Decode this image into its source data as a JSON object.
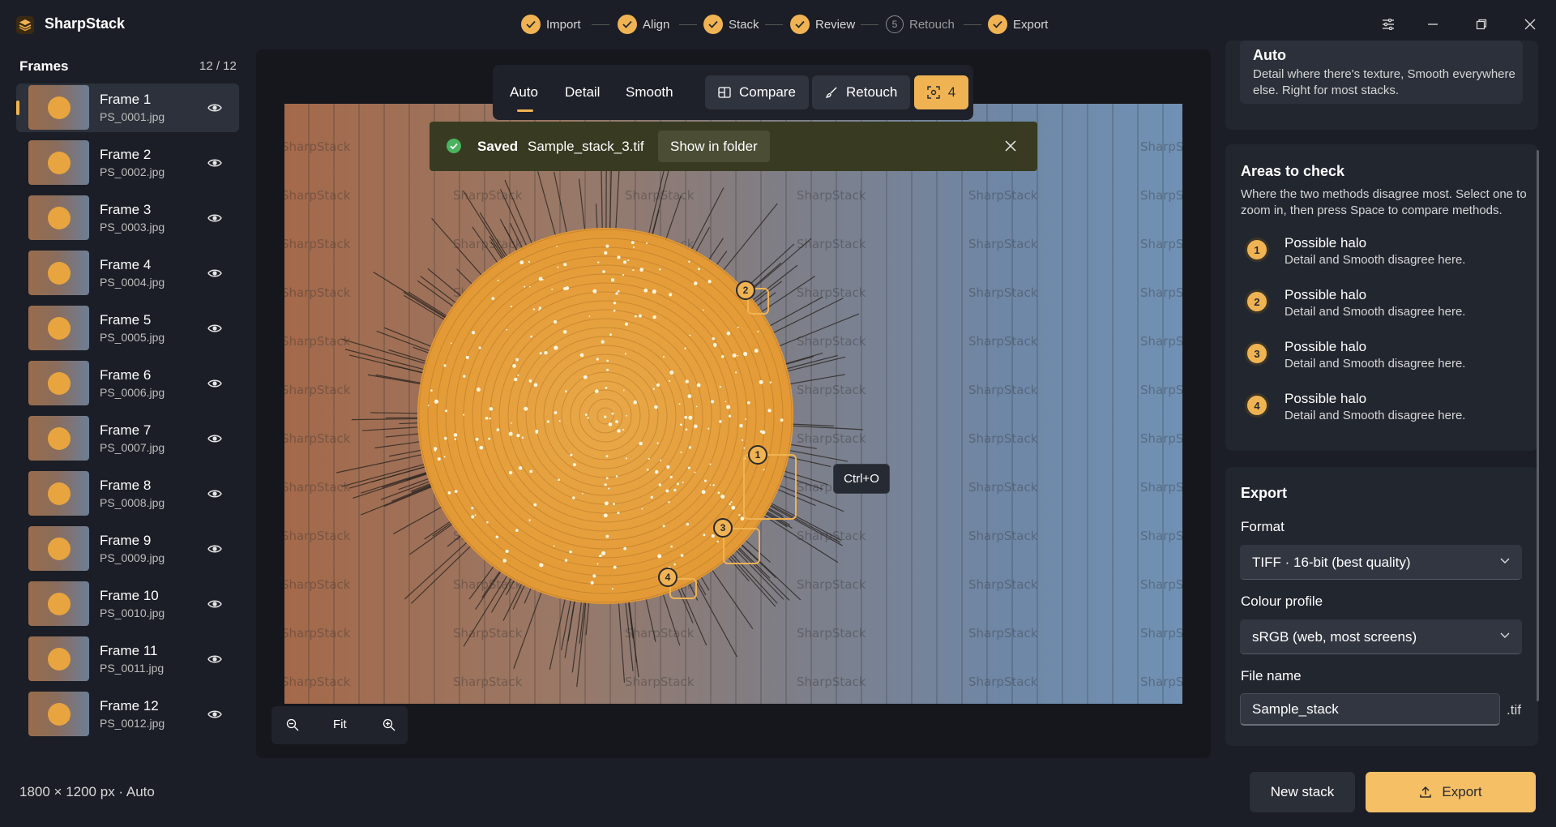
{
  "app": {
    "title": "SharpStack"
  },
  "steps": [
    {
      "label": "Import",
      "state": "done"
    },
    {
      "label": "Align",
      "state": "done"
    },
    {
      "label": "Stack",
      "state": "done"
    },
    {
      "label": "Review",
      "state": "done"
    },
    {
      "label": "Retouch",
      "state": "pending",
      "number": "5"
    },
    {
      "label": "Export",
      "state": "done"
    }
  ],
  "frames": {
    "title": "Frames",
    "count": "12 / 12",
    "items": [
      {
        "name": "Frame 1",
        "file": "PS_0001.jpg"
      },
      {
        "name": "Frame 2",
        "file": "PS_0002.jpg"
      },
      {
        "name": "Frame 3",
        "file": "PS_0003.jpg"
      },
      {
        "name": "Frame 4",
        "file": "PS_0004.jpg"
      },
      {
        "name": "Frame 5",
        "file": "PS_0005.jpg"
      },
      {
        "name": "Frame 6",
        "file": "PS_0006.jpg"
      },
      {
        "name": "Frame 7",
        "file": "PS_0007.jpg"
      },
      {
        "name": "Frame 8",
        "file": "PS_0008.jpg"
      },
      {
        "name": "Frame 9",
        "file": "PS_0009.jpg"
      },
      {
        "name": "Frame 10",
        "file": "PS_0010.jpg"
      },
      {
        "name": "Frame 11",
        "file": "PS_0011.jpg"
      },
      {
        "name": "Frame 12",
        "file": "PS_0012.jpg"
      }
    ]
  },
  "status": {
    "dims": "1800 × 1200 px · Auto"
  },
  "viewer": {
    "modes": [
      "Auto",
      "Detail",
      "Smooth"
    ],
    "compare_label": "Compare",
    "retouch_label": "Retouch",
    "overlay_count": "4",
    "watermark": "SharpStack",
    "zoom_fit_label": "Fit",
    "tooltip": "Ctrl+O",
    "area_badges": [
      "1",
      "2",
      "3",
      "4"
    ]
  },
  "toast": {
    "saved": "Saved",
    "file": "Sample_stack_3.tif",
    "action": "Show in folder"
  },
  "right": {
    "auto_title": "Auto",
    "auto_desc": "Detail where there's texture, Smooth everywhere else. Right for most stacks.",
    "areas_title": "Areas to check",
    "areas_desc": "Where the two methods disagree most. Select one to zoom in, then press Space to compare methods.",
    "areas": [
      {
        "num": "1",
        "title": "Possible halo",
        "desc": "Detail and Smooth disagree here."
      },
      {
        "num": "2",
        "title": "Possible halo",
        "desc": "Detail and Smooth disagree here."
      },
      {
        "num": "3",
        "title": "Possible halo",
        "desc": "Detail and Smooth disagree here."
      },
      {
        "num": "4",
        "title": "Possible halo",
        "desc": "Detail and Smooth disagree here."
      }
    ],
    "export_title": "Export",
    "format_label": "Format",
    "format_value": "TIFF · 16-bit (best quality)",
    "profile_label": "Colour profile",
    "profile_value": "sRGB (web, most screens)",
    "filename_label": "File name",
    "filename_value": "Sample_stack",
    "filename_ext": ".tif"
  },
  "footer": {
    "new_stack": "New stack",
    "export": "Export"
  },
  "colors": {
    "accent": "#f0b353",
    "background": "#1b1e26",
    "toast": "#383b21"
  }
}
